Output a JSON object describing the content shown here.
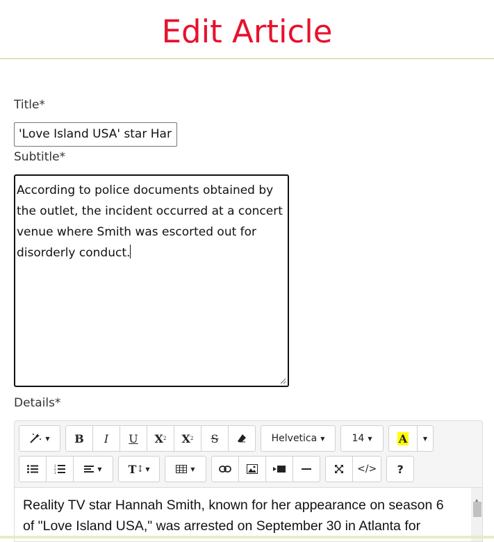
{
  "page": {
    "title": "Edit Article"
  },
  "form": {
    "title_label": "Title*",
    "title_value": "'Love Island USA' star Har",
    "subtitle_label": "Subtitle*",
    "subtitle_value": "According to police documents obtained by the outlet, the incident occurred at a concert venue where Smith was escorted out for disorderly conduct.",
    "details_label": "Details*"
  },
  "toolbar": {
    "font_family": "Helvetica",
    "font_size": "14",
    "highlight_letter": "A",
    "bold": "B",
    "italic": "I",
    "underline": "U",
    "superscript": "X",
    "subscript": "X",
    "strikethrough": "S",
    "line_height": "T",
    "help": "?",
    "code_view": "</>",
    "highlight_color": "#ffff00"
  },
  "editor": {
    "content": "Reality TV star Hannah Smith, known for her appearance on season 6 of \"Love Island USA,\" was arrested on September 30 in Atlanta for"
  },
  "colors": {
    "title": "#e8112d",
    "divider": "#c9c98a"
  }
}
